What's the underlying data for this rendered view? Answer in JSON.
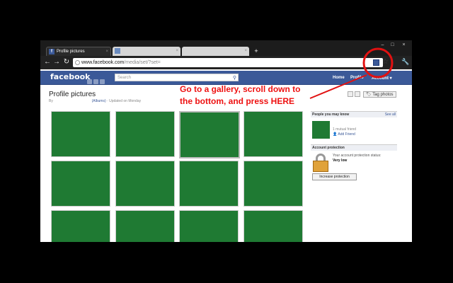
{
  "browser": {
    "tabs": [
      {
        "label": "Profile pictures",
        "favicon": "f",
        "active": true
      },
      {
        "label": "",
        "active": false
      },
      {
        "label": "",
        "active": false
      }
    ],
    "new_tab_symbol": "+",
    "window_controls": {
      "minimize": "–",
      "maximize": "□",
      "close": "×"
    },
    "nav": {
      "back": "←",
      "forward": "→",
      "reload": "↻"
    },
    "url_host": "www.facebook.com",
    "url_path": "/media/set/?set="
  },
  "facebook": {
    "logo": "facebook",
    "search_placeholder": "Search",
    "nav_items": [
      "Home",
      "Profile",
      "Account ▾"
    ],
    "page": {
      "title": "Profile pictures",
      "subtitle_prefix": "By",
      "albums_link": "(Albums)",
      "updated": "· Updated on Monday"
    },
    "tag_button": "Tag photos",
    "sidebar": {
      "pymk_heading": "People you may know",
      "see_all": "See all",
      "mutual": "1 mutual friend",
      "add_friend": "Add Friend",
      "protection_heading": "Account protection",
      "protection_status": "Your account protection status:",
      "protection_level": "Very low",
      "increase_button": "Increase protection"
    }
  },
  "annotation": {
    "line1": "Go to a gallery, scroll down to",
    "line2": "the bottom, and press HERE"
  },
  "colors": {
    "fb_blue": "#3b5998",
    "photo_green": "#1f7a33",
    "annotation_red": "#e11111"
  }
}
